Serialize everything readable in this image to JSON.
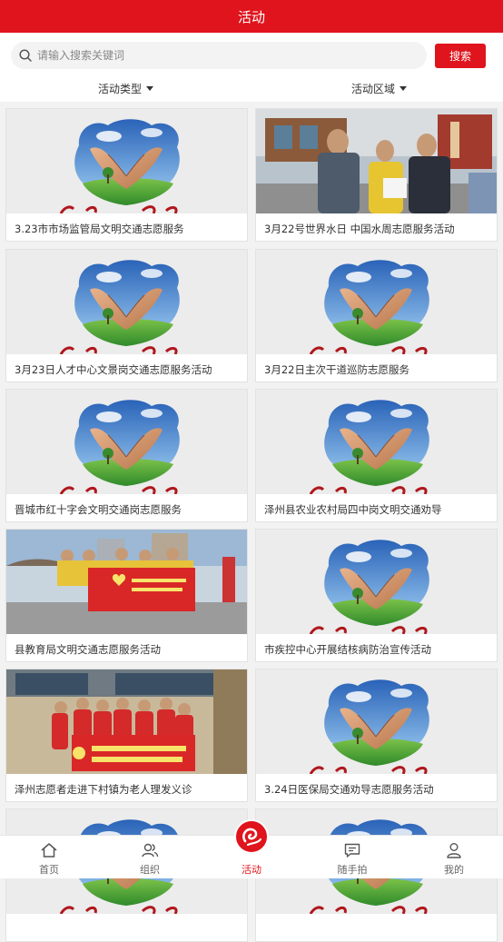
{
  "header": {
    "title": "活动"
  },
  "search": {
    "placeholder": "请输入搜索关键词",
    "button_label": "搜索"
  },
  "filters": {
    "type_label": "活动类型",
    "area_label": "活动区域"
  },
  "activities": [
    {
      "title": "3.23市市场监管局文明交通志愿服务",
      "image": "heart-logo-image"
    },
    {
      "title": "3月22号世界水日 中国水周志愿服务活动",
      "image": "volunteers-street-photo"
    },
    {
      "title": "3月23日人才中心文景岗交通志愿服务活动",
      "image": "heart-logo-image"
    },
    {
      "title": "3月22日主次干道巡防志愿服务",
      "image": "heart-logo-image"
    },
    {
      "title": "晋城市红十字会文明交通岗志愿服务",
      "image": "heart-logo-image"
    },
    {
      "title": "泽州县农业农村局四中岗文明交通劝导",
      "image": "heart-logo-image"
    },
    {
      "title": "县教育局文明交通志愿服务活动",
      "image": "group-banner-photo"
    },
    {
      "title": "市疾控中心开展结核病防治宣传活动",
      "image": "heart-logo-image"
    },
    {
      "title": "泽州志愿者走进下村镇为老人理发义诊",
      "image": "association-banner-photo"
    },
    {
      "title": "3.24日医保局交通劝导志愿服务活动",
      "image": "heart-logo-image"
    }
  ],
  "tabbar": {
    "home": "首页",
    "org": "组织",
    "activity": "活动",
    "snapshot": "随手拍",
    "mine": "我的"
  },
  "colors": {
    "brand": "#e0141c"
  }
}
